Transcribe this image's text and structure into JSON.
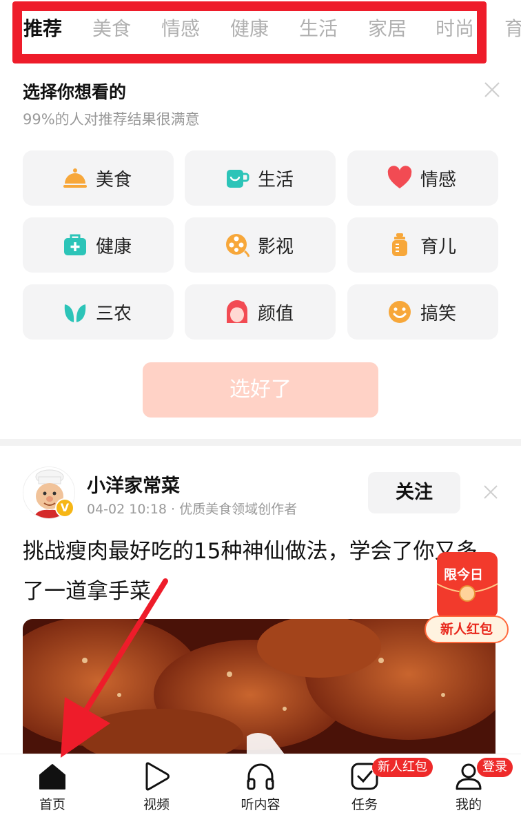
{
  "tabs": [
    "推荐",
    "美食",
    "情感",
    "健康",
    "生活",
    "家居",
    "时尚",
    "育"
  ],
  "preference": {
    "title": "选择你想看的",
    "subtitle": "99%的人对推荐结果很满意",
    "categories": [
      {
        "label": "美食",
        "icon": "food-cloche-icon",
        "color": "#f7a73a"
      },
      {
        "label": "生活",
        "icon": "cup-icon",
        "color": "#2cc4b8"
      },
      {
        "label": "情感",
        "icon": "heart-icon",
        "color": "#f24b53"
      },
      {
        "label": "健康",
        "icon": "medical-kit-icon",
        "color": "#2cc4b8"
      },
      {
        "label": "影视",
        "icon": "film-reel-icon",
        "color": "#f7a73a"
      },
      {
        "label": "育儿",
        "icon": "baby-bottle-icon",
        "color": "#f7a73a"
      },
      {
        "label": "三农",
        "icon": "leaf-icon",
        "color": "#2cc4b8"
      },
      {
        "label": "颜值",
        "icon": "face-icon",
        "color": "#f24b53"
      },
      {
        "label": "搞笑",
        "icon": "smile-icon",
        "color": "#f7a73a"
      }
    ],
    "done_label": "选好了"
  },
  "post": {
    "author": "小洋家常菜",
    "meta": "04-02 10:18 · 优质美食领域创作者",
    "follow_label": "关注",
    "title": "挑战瘦肉最好吃的15种神仙做法，学会了你又多了一道拿手菜"
  },
  "promo": {
    "top_text": "限今日",
    "label": "新人红包"
  },
  "bottom_nav": [
    {
      "label": "首页",
      "icon": "home-icon"
    },
    {
      "label": "视频",
      "icon": "play-icon"
    },
    {
      "label": "听内容",
      "icon": "headphones-icon"
    },
    {
      "label": "任务",
      "icon": "task-check-icon",
      "badge": "新人红包"
    },
    {
      "label": "我的",
      "icon": "user-icon",
      "badge": "登录"
    }
  ],
  "colors": {
    "accent_red": "#ee1c2a",
    "done_button": "#ffd2c6",
    "card_bg": "#f4f4f5"
  }
}
